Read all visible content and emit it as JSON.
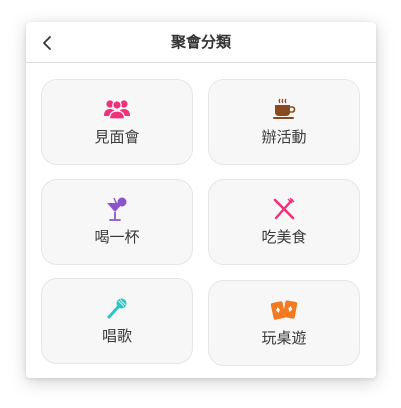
{
  "header": {
    "title": "聚會分類"
  },
  "categories": [
    {
      "label": "見面會",
      "icon": "people-group-icon",
      "color": "#f0307a"
    },
    {
      "label": "辦活動",
      "icon": "coffee-cup-icon",
      "color": "#8a4a20"
    },
    {
      "label": "喝一杯",
      "icon": "cocktail-icon",
      "color": "#8a55c8"
    },
    {
      "label": "吃美食",
      "icon": "fork-knife-icon",
      "color": "#f0307a"
    },
    {
      "label": "唱歌",
      "icon": "microphone-icon",
      "color": "#2ec4c4"
    },
    {
      "label": "玩桌遊",
      "icon": "playing-cards-icon",
      "color": "#f57a1f"
    }
  ]
}
